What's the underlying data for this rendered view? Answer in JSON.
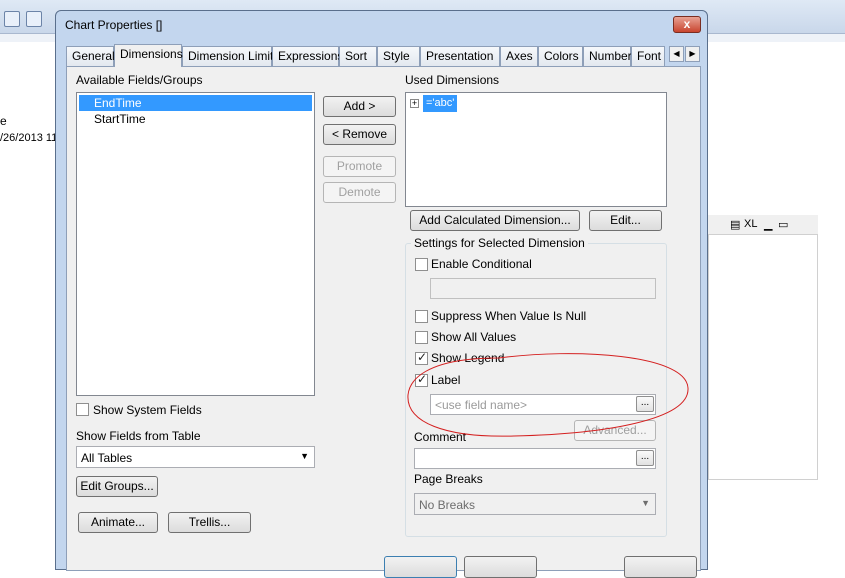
{
  "background": {
    "sheet_text_1": "e",
    "sheet_text_2": "/26/2013 11",
    "side_panel_label": "XL"
  },
  "dialog": {
    "title": "Chart Properties []",
    "close_label": "x",
    "tabs": [
      {
        "label": "General"
      },
      {
        "label": "Dimensions"
      },
      {
        "label": "Dimension Limits"
      },
      {
        "label": "Expressions"
      },
      {
        "label": "Sort"
      },
      {
        "label": "Style"
      },
      {
        "label": "Presentation"
      },
      {
        "label": "Axes"
      },
      {
        "label": "Colors"
      },
      {
        "label": "Number"
      },
      {
        "label": "Font"
      }
    ],
    "available": {
      "label": "Available Fields/Groups",
      "items": [
        "EndTime",
        "StartTime"
      ],
      "show_system_fields": "Show System Fields",
      "show_from_table_label": "Show Fields from Table",
      "table_select_value": "All Tables",
      "edit_groups": "Edit Groups...",
      "animate": "Animate...",
      "trellis": "Trellis..."
    },
    "middle_buttons": {
      "add": "Add >",
      "remove": "< Remove",
      "promote": "Promote",
      "demote": "Demote"
    },
    "used": {
      "label": "Used Dimensions",
      "expand_glyph": "+",
      "items": [
        "='abc'"
      ],
      "add_calculated": "Add Calculated Dimension...",
      "edit": "Edit..."
    },
    "settings": {
      "title": "Settings for Selected Dimension",
      "enable_conditional": "Enable Conditional",
      "suppress_null": "Suppress When Value Is Null",
      "show_all_values": "Show All Values",
      "show_legend": "Show Legend",
      "label": "Label",
      "label_placeholder": "<use field name>",
      "advanced": "Advanced...",
      "comment": "Comment",
      "page_breaks": "Page Breaks",
      "page_breaks_value": "No Breaks",
      "ellipsis": "..."
    }
  }
}
